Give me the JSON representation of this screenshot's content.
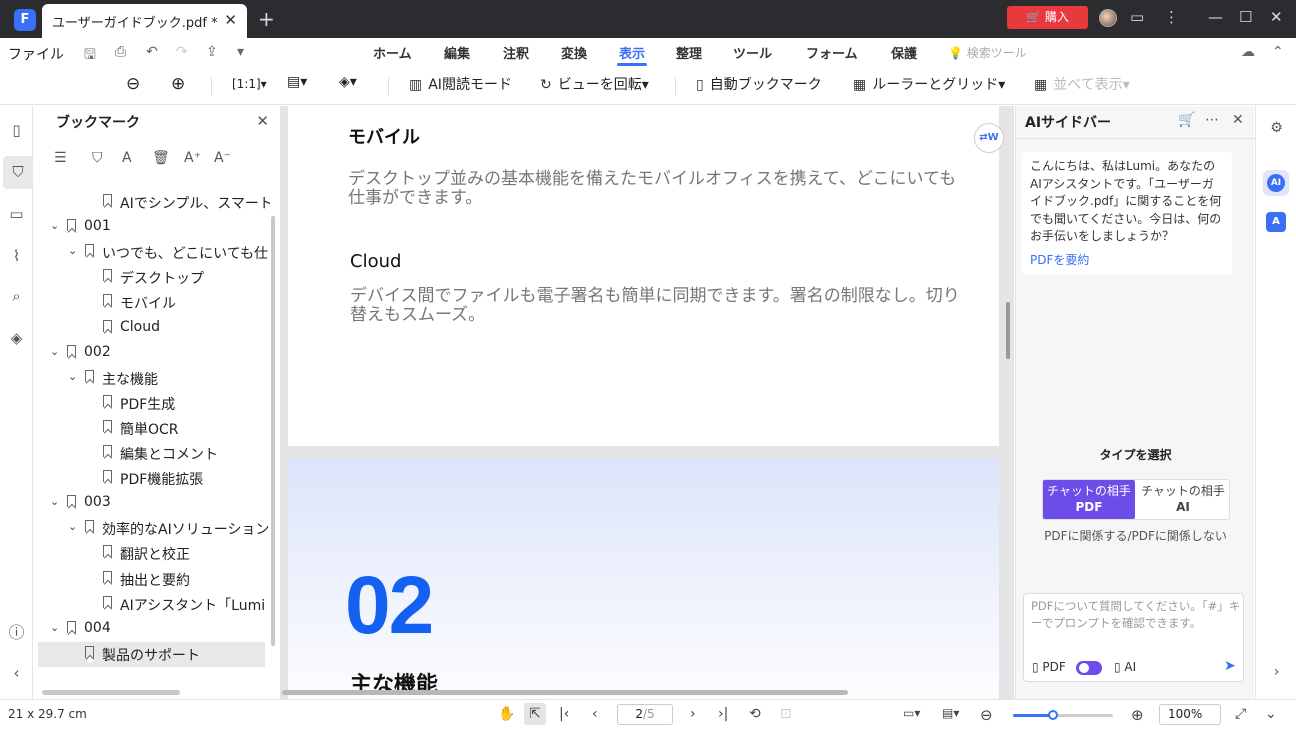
{
  "titlebar": {
    "doc_tab_title": "ユーザーガイドブック.pdf *",
    "buy_label": "購入"
  },
  "menu": {
    "file": "ファイル",
    "tabs": [
      "ホーム",
      "編集",
      "注釈",
      "変換",
      "表示",
      "整理",
      "ツール",
      "フォーム",
      "保護"
    ],
    "active_tab": "表示",
    "search_tools": "検索ツール"
  },
  "toolbar": {
    "ai_reading": "AI閲読モード",
    "rotate_view": "ビューを回転",
    "auto_bookmark": "自動ブックマーク",
    "ruler_grid": "ルーラーとグリッド",
    "side_by_side": "並べて表示"
  },
  "bookmarks": {
    "title": "ブックマーク",
    "items": [
      {
        "label": "AIでシンプル、スマートな",
        "level": 2,
        "caret": false,
        "selected": false
      },
      {
        "label": "001",
        "level": 0,
        "caret": true,
        "selected": false
      },
      {
        "label": "いつでも、どこにいても仕",
        "level": 1,
        "caret": true,
        "selected": false
      },
      {
        "label": "デスクトップ",
        "level": 2,
        "caret": false,
        "selected": false
      },
      {
        "label": "モバイル",
        "level": 2,
        "caret": false,
        "selected": false
      },
      {
        "label": "Cloud",
        "level": 2,
        "caret": false,
        "selected": false
      },
      {
        "label": "002",
        "level": 0,
        "caret": true,
        "selected": false
      },
      {
        "label": "主な機能",
        "level": 1,
        "caret": true,
        "selected": false
      },
      {
        "label": "PDF生成",
        "level": 2,
        "caret": false,
        "selected": false
      },
      {
        "label": "簡単OCR",
        "level": 2,
        "caret": false,
        "selected": false
      },
      {
        "label": "編集とコメント",
        "level": 2,
        "caret": false,
        "selected": false
      },
      {
        "label": "PDF機能拡張",
        "level": 2,
        "caret": false,
        "selected": false
      },
      {
        "label": "003",
        "level": 0,
        "caret": true,
        "selected": false
      },
      {
        "label": "効率的なAIソリューション",
        "level": 1,
        "caret": true,
        "selected": false
      },
      {
        "label": "翻訳と校正",
        "level": 2,
        "caret": false,
        "selected": false
      },
      {
        "label": "抽出と要約",
        "level": 2,
        "caret": false,
        "selected": false
      },
      {
        "label": "AIアシスタント「Lumi",
        "level": 2,
        "caret": false,
        "selected": false
      },
      {
        "label": "004",
        "level": 0,
        "caret": true,
        "selected": false
      },
      {
        "label": "製品のサポート",
        "level": 1,
        "caret": false,
        "selected": true
      }
    ]
  },
  "document": {
    "mobile_heading": "モバイル",
    "mobile_body": "デスクトップ並みの基本機能を備えたモバイルオフィスを携えて、どこにいても仕事ができます。",
    "cloud_heading": "Cloud",
    "cloud_body": "デバイス間でファイルも電子署名も簡単に同期できます。署名の制限なし。切り替えもスムーズ。",
    "section_number": "02",
    "section_title": "主な機能"
  },
  "ai_sidebar": {
    "title": "AIサイドバー",
    "greeting": "こんにちは、私はLumi。あなたのAIアシスタントです。「ユーザーガイドブック.pdf」に関することを何でも聞いてください。今日は、何のお手伝いをしましょうか？",
    "summarize_link": "PDFを要約",
    "type_title": "タイプを選択",
    "option_pdf_line1": "チャットの相手",
    "option_pdf_line2": "PDF",
    "option_ai_line1": "チャットの相手",
    "option_ai_line2": "AI",
    "type_caption": "PDFに関係する/PDFに関係しない",
    "input_placeholder": "PDFについて質問してください。「#」キーでプロンプトを確認できます。",
    "mode_pdf": "PDF",
    "mode_ai": "AI"
  },
  "statusbar": {
    "page_size": "21 x 29.7 cm",
    "current_page": "2",
    "total_pages": "/5",
    "zoom": "100%",
    "zoom_fraction": 0.4
  }
}
